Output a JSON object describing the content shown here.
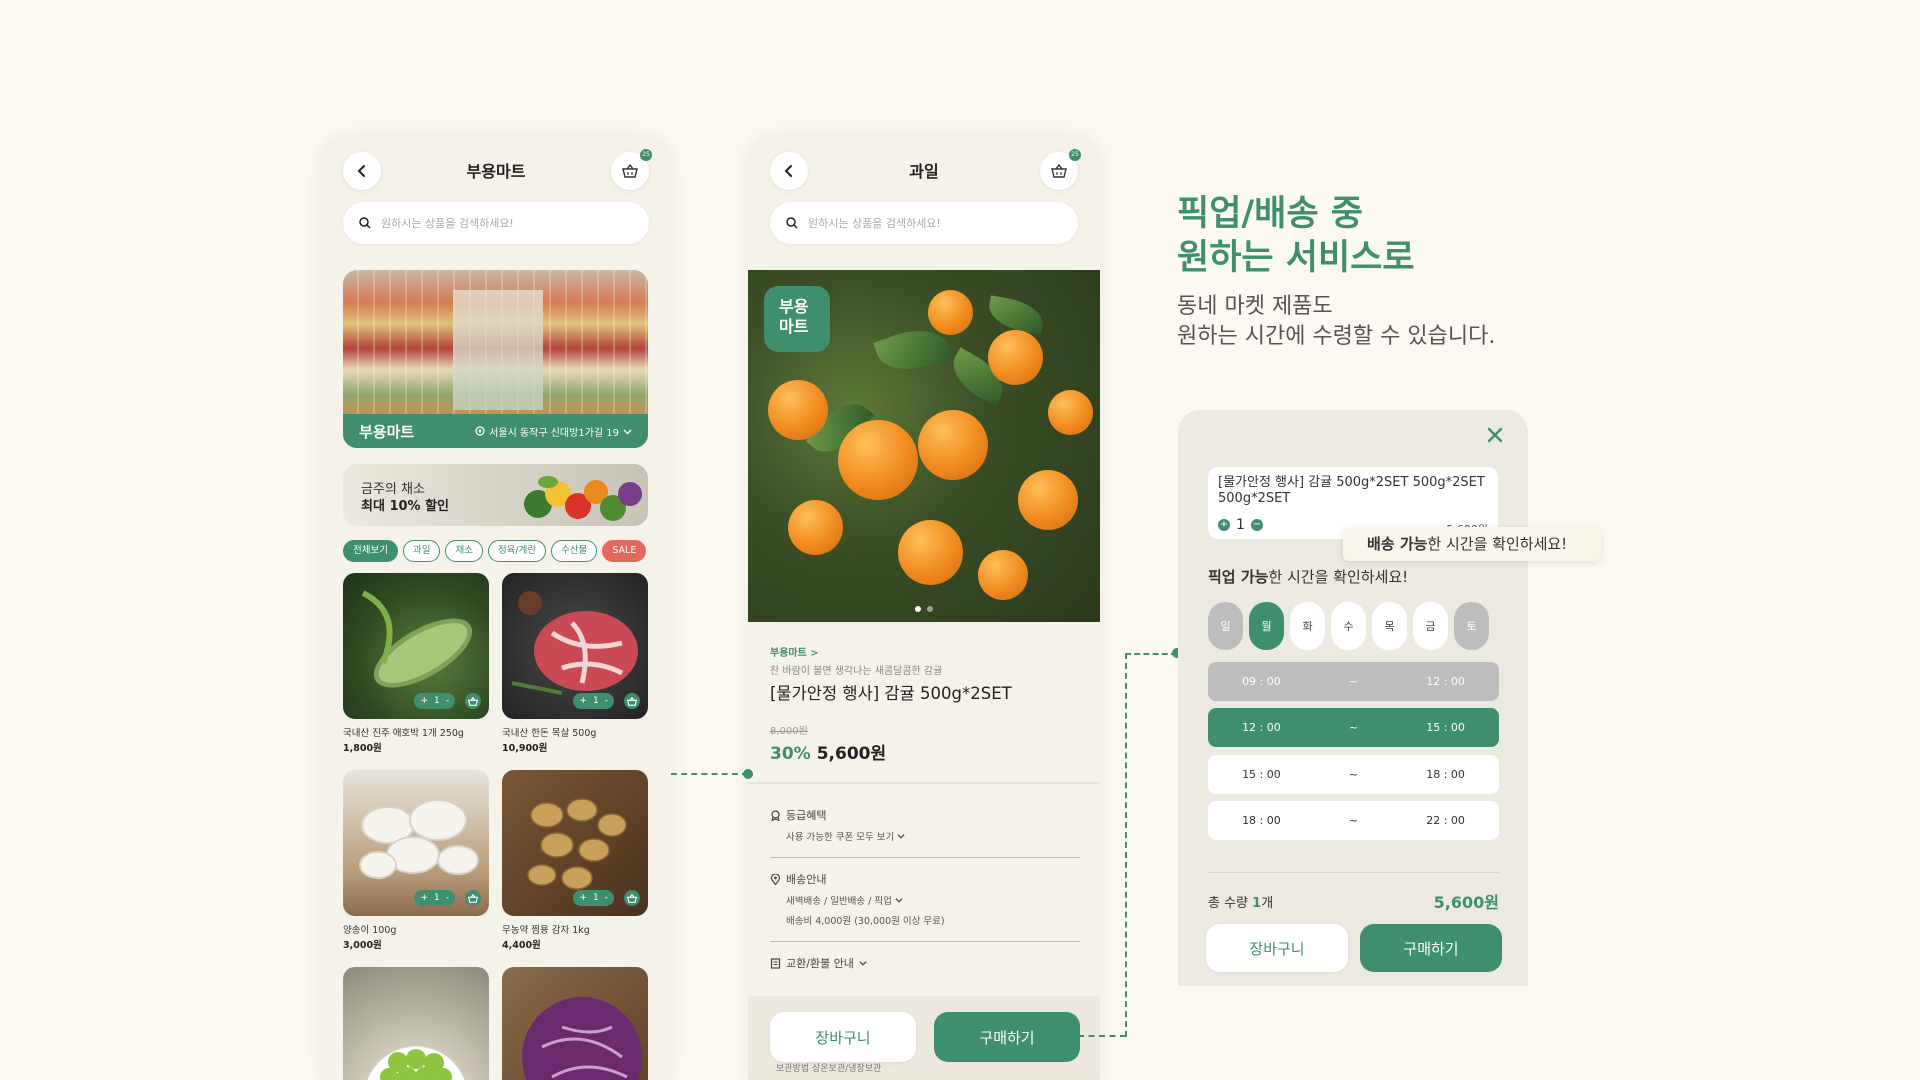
{
  "screen1": {
    "title": "부용마트",
    "cart_badge": "25",
    "search_placeholder": "원하시는 상품을 검색하세요!",
    "banner": {
      "name": "부용마트",
      "address": "서울시 동작구 신대방1가길 19"
    },
    "promo": {
      "line1": "금주의 채소",
      "line2": "최대 10% 할인"
    },
    "chips": [
      "전체보기",
      "과일",
      "채소",
      "정육/계란",
      "수산물",
      "SALE"
    ],
    "stepper": {
      "minus": "-",
      "qty": "1",
      "plus": "+"
    },
    "products": [
      {
        "name": "국내산 진주 애호박 1개 250g",
        "price": "1,800원"
      },
      {
        "name": "국내산 한돈 목살 500g",
        "price": "10,900원"
      },
      {
        "name": "양송이 100g",
        "price": "3,000원"
      },
      {
        "name": "무농약 찜용 감자 1kg",
        "price": "4,400원"
      }
    ]
  },
  "screen2": {
    "title": "과일",
    "cart_badge": "25",
    "search_placeholder": "원하시는 상품을 검색하세요!",
    "badge_line1": "부용",
    "badge_line2": "마트",
    "store_link": "부용마트 >",
    "subtitle": "찬 바람이 불면 생각나는 새콤달콤한 감귤",
    "product_title": "[물가안정 행사] 감귤 500g*2SET",
    "old_price": "8,000원",
    "discount": "30%",
    "price": "5,600원",
    "grade_title": "등급혜택",
    "grade_detail": "사용 가능한 쿠폰 모두 보기",
    "delivery_title": "배송안내",
    "delivery_detail1": "새벽배송 / 일반배송 / 픽업",
    "delivery_detail2": "배송비 4,000원 (30,000원 이상 무료)",
    "exchange_title": "교환/환불 안내",
    "cart_button": "장바구니",
    "buy_button": "구매하기",
    "foot_note": "보관방법 상온보관/냉장보관"
  },
  "headline": {
    "line1": "픽업/배송 중",
    "line2": "원하는 서비스로"
  },
  "subline": {
    "line1": "동네 마켓 제품도",
    "line2": "원하는 시간에 수령할 수 있습니다."
  },
  "modal": {
    "option_title": "[물가안정 행사] 감귤 500g*2SET 500g*2SET 500g*2SET",
    "option_qty": "1",
    "option_price": "5,600원",
    "tooltip_bold": "배송 가능",
    "tooltip_rest": "한 시간을 확인하세요!",
    "pick_bold": "픽업 가능",
    "pick_rest": "한 시간을 확인하세요!",
    "days": [
      "일",
      "월",
      "화",
      "수",
      "목",
      "금",
      "토"
    ],
    "slots": [
      {
        "from": "09 : 00",
        "sep": "~",
        "to": "12 : 00"
      },
      {
        "from": "12 : 00",
        "sep": "~",
        "to": "15 : 00"
      },
      {
        "from": "15 : 00",
        "sep": "~",
        "to": "18 : 00"
      },
      {
        "from": "18 : 00",
        "sep": "~",
        "to": "22 : 00"
      }
    ],
    "total_label": "총 수량",
    "total_qty": "1",
    "total_unit": "개",
    "total_price": "5,600원",
    "cart_button": "장바구니",
    "buy_button": "구매하기"
  },
  "colors": {
    "accent": "#3f8f6e",
    "sale": "#e4685b",
    "background": "#fcf9f2",
    "disabled": "#bdbdbd"
  }
}
